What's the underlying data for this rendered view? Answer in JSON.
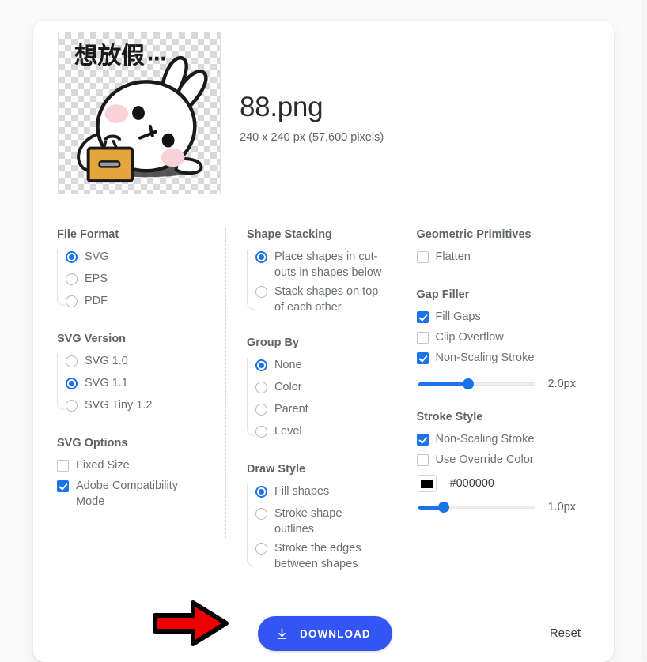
{
  "file": {
    "name": "88.png",
    "dimensions": "240 x 240 px (57,600 pixels)",
    "thumbnail_alt": "想放假…"
  },
  "columns": {
    "left": {
      "file_format": {
        "title": "File Format",
        "options": [
          {
            "label": "SVG",
            "selected": true
          },
          {
            "label": "EPS",
            "selected": false
          },
          {
            "label": "PDF",
            "selected": false
          }
        ]
      },
      "svg_version": {
        "title": "SVG Version",
        "options": [
          {
            "label": "SVG 1.0",
            "selected": false
          },
          {
            "label": "SVG 1.1",
            "selected": true
          },
          {
            "label": "SVG Tiny 1.2",
            "selected": false
          }
        ]
      },
      "svg_options": {
        "title": "SVG Options",
        "options": [
          {
            "label": "Fixed Size",
            "checked": false
          },
          {
            "label": "Adobe Compatibility Mode",
            "checked": true
          }
        ]
      }
    },
    "middle": {
      "shape_stacking": {
        "title": "Shape Stacking",
        "options": [
          {
            "label": "Place shapes in cut-outs in shapes below",
            "selected": true
          },
          {
            "label": "Stack shapes on top of each other",
            "selected": false
          }
        ]
      },
      "group_by": {
        "title": "Group By",
        "options": [
          {
            "label": "None",
            "selected": true
          },
          {
            "label": "Color",
            "selected": false
          },
          {
            "label": "Parent",
            "selected": false
          },
          {
            "label": "Level",
            "selected": false
          }
        ]
      },
      "draw_style": {
        "title": "Draw Style",
        "options": [
          {
            "label": "Fill shapes",
            "selected": true
          },
          {
            "label": "Stroke shape outlines",
            "selected": false
          },
          {
            "label": "Stroke the edges between shapes",
            "selected": false
          }
        ]
      }
    },
    "right": {
      "geometric_primitives": {
        "title": "Geometric Primitives",
        "options": [
          {
            "label": "Flatten",
            "checked": false
          }
        ]
      },
      "gap_filler": {
        "title": "Gap Filler",
        "options": [
          {
            "label": "Fill Gaps",
            "checked": true
          },
          {
            "label": "Clip Overflow",
            "checked": false
          },
          {
            "label": "Non-Scaling Stroke",
            "checked": true
          }
        ],
        "slider": {
          "value": "2.0px",
          "percent": 43
        }
      },
      "stroke_style": {
        "title": "Stroke Style",
        "options": [
          {
            "label": "Non-Scaling Stroke",
            "checked": true
          },
          {
            "label": "Use Override Color",
            "checked": false
          }
        ],
        "color": {
          "hex": "#000000",
          "label": "#000000"
        },
        "slider": {
          "value": "1.0px",
          "percent": 22
        }
      }
    }
  },
  "footer": {
    "download_label": "DOWNLOAD",
    "reset_label": "Reset"
  },
  "colors": {
    "accent_blue": "#1a73e8",
    "button_blue": "#3355f5",
    "annotation_red": "#ee0000"
  }
}
